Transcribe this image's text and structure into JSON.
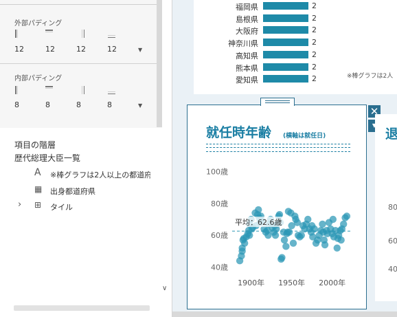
{
  "left_panel": {
    "outer_padding": {
      "title": "外部パディング",
      "values": [
        "12",
        "12",
        "12",
        "12"
      ]
    },
    "inner_padding": {
      "title": "内部パディング",
      "values": [
        "8",
        "8",
        "8",
        "8"
      ]
    },
    "hierarchy": {
      "title": "項目の階層",
      "root": "歴代総理大臣一覧",
      "items": [
        {
          "icon": "text-icon",
          "glyph": "A",
          "label": "※棒グラフは2人以上の都道府"
        },
        {
          "icon": "sheet-icon",
          "glyph": "▦",
          "label": "出身都道府県"
        },
        {
          "icon": "tile-icon",
          "glyph": "⊞",
          "label": "タイル",
          "expander": "›"
        }
      ]
    }
  },
  "top_chart": {
    "rows": [
      {
        "label": "福岡県",
        "value": "2"
      },
      {
        "label": "島根県",
        "value": "2"
      },
      {
        "label": "大阪府",
        "value": "2"
      },
      {
        "label": "神奈川県",
        "value": "2"
      },
      {
        "label": "高知県",
        "value": "2"
      },
      {
        "label": "熊本県",
        "value": "2"
      },
      {
        "label": "愛知県",
        "value": "2"
      }
    ],
    "note": "※棒グラフは2人"
  },
  "selected_card": {
    "title": "就任時年齢",
    "subtitle": "(横軸は就任日)",
    "close_symbol": "✕",
    "menu_symbol": "▼"
  },
  "right_card": {
    "title_fragment": "退"
  },
  "chart_data": {
    "type": "scatter",
    "title": "就任時年齢",
    "subtitle": "(横軸は就任日)",
    "x_ticks": [
      "1900年",
      "1950年",
      "2000年"
    ],
    "y_ticks": [
      "100歳",
      "80歳",
      "60歳",
      "40歳"
    ],
    "xlim": [
      1880,
      2024
    ],
    "ylim": [
      35,
      105
    ],
    "average_label": "平均：62.6歳",
    "average": 62.6,
    "color": "#2b97b5",
    "points": [
      [
        1886,
        44
      ],
      [
        1888,
        47
      ],
      [
        1889,
        50
      ],
      [
        1889,
        52
      ],
      [
        1890,
        57
      ],
      [
        1891,
        58
      ],
      [
        1892,
        55
      ],
      [
        1894,
        59
      ],
      [
        1896,
        61
      ],
      [
        1897,
        63
      ],
      [
        1898,
        67
      ],
      [
        1898,
        60
      ],
      [
        1900,
        70
      ],
      [
        1901,
        64
      ],
      [
        1902,
        65
      ],
      [
        1905,
        74
      ],
      [
        1906,
        66
      ],
      [
        1908,
        73
      ],
      [
        1909,
        76
      ],
      [
        1910,
        71
      ],
      [
        1911,
        68
      ],
      [
        1912,
        72
      ],
      [
        1914,
        69
      ],
      [
        1916,
        64
      ],
      [
        1918,
        62
      ],
      [
        1920,
        63
      ],
      [
        1921,
        60
      ],
      [
        1922,
        67
      ],
      [
        1924,
        70
      ],
      [
        1926,
        65
      ],
      [
        1928,
        62
      ],
      [
        1929,
        66
      ],
      [
        1930,
        60
      ],
      [
        1931,
        64
      ],
      [
        1932,
        67
      ],
      [
        1934,
        72
      ],
      [
        1935,
        73
      ],
      [
        1936,
        68
      ],
      [
        1937,
        45
      ],
      [
        1938,
        46
      ],
      [
        1940,
        62
      ],
      [
        1941,
        57
      ],
      [
        1943,
        53
      ],
      [
        1944,
        61
      ],
      [
        1945,
        62
      ],
      [
        1946,
        75
      ],
      [
        1947,
        62
      ],
      [
        1949,
        74
      ],
      [
        1950,
        66
      ],
      [
        1952,
        55
      ],
      [
        1954,
        72
      ],
      [
        1955,
        70
      ],
      [
        1957,
        68
      ],
      [
        1958,
        60
      ],
      [
        1960,
        59
      ],
      [
        1962,
        60
      ],
      [
        1964,
        66
      ],
      [
        1966,
        64
      ],
      [
        1968,
        67
      ],
      [
        1970,
        70
      ],
      [
        1972,
        64
      ],
      [
        1974,
        62
      ],
      [
        1975,
        66
      ],
      [
        1976,
        59
      ],
      [
        1978,
        64
      ],
      [
        1980,
        55
      ],
      [
        1982,
        57
      ],
      [
        1984,
        60
      ],
      [
        1986,
        63
      ],
      [
        1988,
        67
      ],
      [
        1989,
        62
      ],
      [
        1990,
        57
      ],
      [
        1991,
        54
      ],
      [
        1993,
        63
      ],
      [
        1994,
        61
      ],
      [
        1996,
        68
      ],
      [
        1998,
        64
      ],
      [
        2000,
        61
      ],
      [
        2001,
        70
      ],
      [
        2002,
        59
      ],
      [
        2004,
        63
      ],
      [
        2006,
        52
      ],
      [
        2007,
        58
      ],
      [
        2008,
        60
      ],
      [
        2010,
        63
      ],
      [
        2011,
        57
      ],
      [
        2012,
        64
      ],
      [
        2014,
        67
      ],
      [
        2016,
        71
      ],
      [
        2018,
        72
      ]
    ]
  }
}
